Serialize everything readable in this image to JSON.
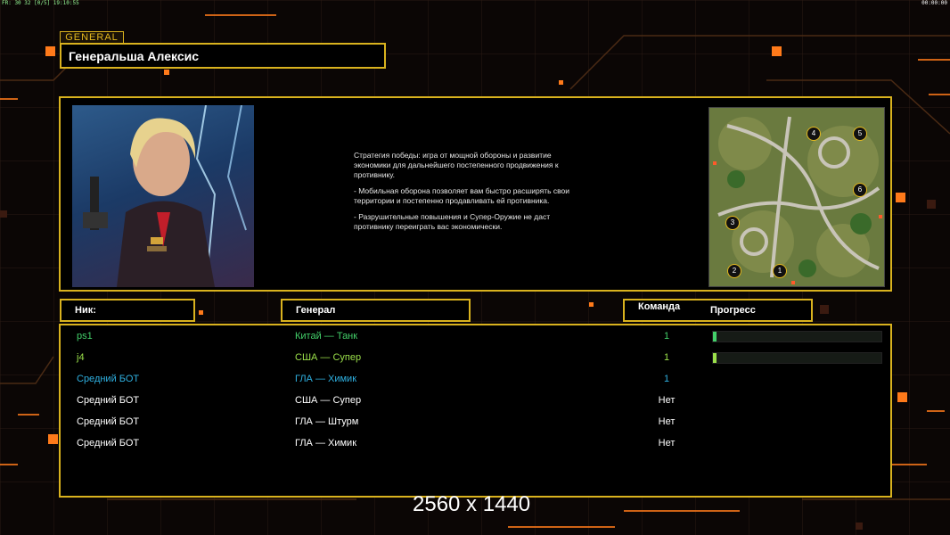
{
  "hud": {
    "left_text": "FR: 30 32 [0/5] 19:10:55",
    "right_text": "00:00:00"
  },
  "general_tag": "GENERAL",
  "general_name": "Генеральша Алексис",
  "strategy": {
    "p1": "Стратегия победы: игра от мощной обороны и развитие\n экономики для дальнейшего постепенного продвижения к\n противнику.",
    "p2": "- Мобильная оборона позволяет вам быстро расширять свои\n территории и постепенно продавливать ей противника.",
    "p3": "- Разрушительные повышения и Супер-Оружие не даст\n противнику переиграть вас экономически."
  },
  "map_slots": [
    "1",
    "2",
    "3",
    "4",
    "5",
    "6"
  ],
  "headers": {
    "nick": "Ник:",
    "general": "Генерал",
    "team": "Команда",
    "progress": "Прогресс"
  },
  "players": [
    {
      "nick": "ps1",
      "general": "Китай — Танк",
      "team": "1",
      "progress": 0.02,
      "color": "#43d06a",
      "has_progress": true
    },
    {
      "nick": "j4",
      "general": "США — Супер",
      "team": "1",
      "progress": 0.02,
      "color": "#9be04a",
      "has_progress": true
    },
    {
      "nick": "Средний БОТ",
      "general": "ГЛА — Химик",
      "team": "1",
      "progress": 0,
      "color": "#2fb0e0",
      "has_progress": false
    },
    {
      "nick": "Средний БОТ",
      "general": "США — Супер",
      "team": "Нет",
      "progress": 0,
      "color": "#ffffff",
      "has_progress": false
    },
    {
      "nick": "Средний БОТ",
      "general": "ГЛА — Штурм",
      "team": "Нет",
      "progress": 0,
      "color": "#ffffff",
      "has_progress": false
    },
    {
      "nick": "Средний БОТ",
      "general": "ГЛА — Химик",
      "team": "Нет",
      "progress": 0,
      "color": "#ffffff",
      "has_progress": false
    }
  ],
  "resolution": "2560 x 1440",
  "colors": {
    "accent": "#d9b21e",
    "orange": "#ff7a1a"
  }
}
